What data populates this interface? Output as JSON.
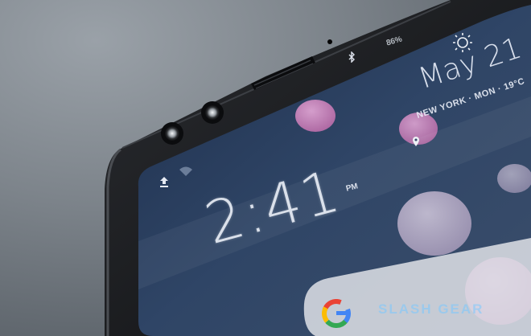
{
  "photo": {
    "subject": "smartphone-top-corner-on-table",
    "colors": {
      "table": "#7d848b",
      "bezel": "#151618",
      "screen": "#2b3f5d",
      "bubble": "#c87fb8",
      "bubble_light": "#d9c6df",
      "watermark": "#78c8ff"
    }
  },
  "lockscreen": {
    "time": "2:41",
    "ampm": "PM",
    "date": "May 21",
    "location_weather": "NEW YORK · MON · 19°C",
    "battery": "86%"
  },
  "watermark": {
    "text": "SLASH GEAR"
  },
  "icons": [
    "upload-icon",
    "wifi-icon",
    "bluetooth-icon",
    "location-pin-icon",
    "google-logo-icon",
    "weather-sun-icon"
  ]
}
